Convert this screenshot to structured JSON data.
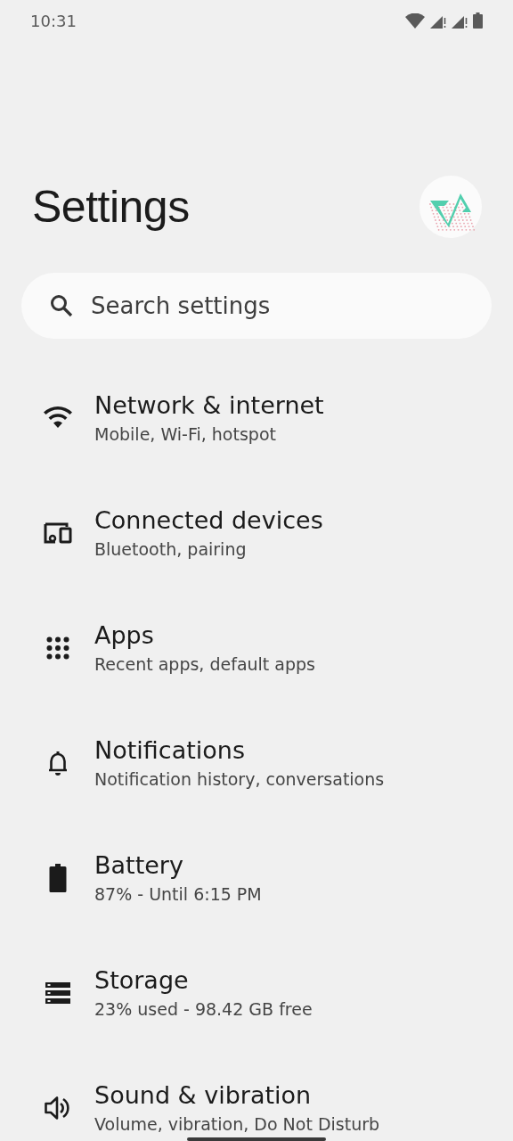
{
  "status_bar": {
    "time": "10:31"
  },
  "title": "Settings",
  "search": {
    "placeholder": "Search settings"
  },
  "items": [
    {
      "kind": "network",
      "title": "Network & internet",
      "subtitle": "Mobile, Wi‑Fi, hotspot"
    },
    {
      "kind": "devices",
      "title": "Connected devices",
      "subtitle": "Bluetooth, pairing"
    },
    {
      "kind": "apps",
      "title": "Apps",
      "subtitle": "Recent apps, default apps"
    },
    {
      "kind": "notifications",
      "title": "Notifications",
      "subtitle": "Notification history, conversations"
    },
    {
      "kind": "battery",
      "title": "Battery",
      "subtitle": "87% - Until 6:15 PM"
    },
    {
      "kind": "storage",
      "title": "Storage",
      "subtitle": "23% used - 98.42 GB free"
    },
    {
      "kind": "sound",
      "title": "Sound & vibration",
      "subtitle": "Volume, vibration, Do Not Disturb"
    }
  ]
}
